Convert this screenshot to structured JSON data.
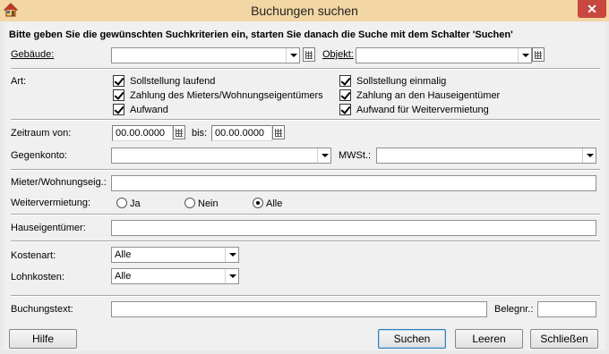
{
  "window": {
    "title": "Buchungen suchen",
    "close_glyph": "✕"
  },
  "instruction": "Bitte geben Sie die gewünschten Suchkriterien ein, starten Sie danach die Suche mit dem Schalter 'Suchen'",
  "gebaeude": {
    "label": "Gebäude:",
    "value": ""
  },
  "objekt": {
    "label": "Objekt:",
    "value": ""
  },
  "art": {
    "label": "Art:",
    "options": [
      {
        "label": "Sollstellung laufend",
        "checked": true
      },
      {
        "label": "Zahlung des Mieters/Wohnungseigentümers",
        "checked": true
      },
      {
        "label": "Aufwand",
        "checked": true
      },
      {
        "label": "Sollstellung einmalig",
        "checked": true
      },
      {
        "label": "Zahlung an den Hauseigentümer",
        "checked": true
      },
      {
        "label": "Aufwand für Weitervermietung",
        "checked": true
      }
    ]
  },
  "zeitraum": {
    "label": "Zeitraum von:",
    "von": "00.00.0000",
    "bis_label": "bis:",
    "bis": "00.00.0000"
  },
  "gegenkonto": {
    "label": "Gegenkonto:",
    "value": ""
  },
  "mwst": {
    "label": "MWSt.:",
    "value": ""
  },
  "mieter": {
    "label": "Mieter/Wohnungseig.:",
    "value": ""
  },
  "weitervermietung": {
    "label": "Weitervermietung:",
    "options": [
      {
        "label": "Ja",
        "selected": false
      },
      {
        "label": "Nein",
        "selected": false
      },
      {
        "label": "Alle",
        "selected": true
      }
    ]
  },
  "hauseigentuemer": {
    "label": "Hauseigentümer:",
    "value": ""
  },
  "kostenart": {
    "label": "Kostenart:",
    "value": "Alle"
  },
  "lohnkosten": {
    "label": "Lohnkosten:",
    "value": "Alle"
  },
  "buchungstext": {
    "label": "Buchungstext:",
    "value": ""
  },
  "belegnr": {
    "label": "Belegnr.:",
    "value": ""
  },
  "buttons": {
    "hilfe": "Hilfe",
    "suchen": "Suchen",
    "leeren": "Leeren",
    "schliessen": "Schließen"
  },
  "icons": {
    "app": "house-icon",
    "calendar": "calendar-icon",
    "dropdown": "chevron-down-icon",
    "close": "close-icon"
  }
}
